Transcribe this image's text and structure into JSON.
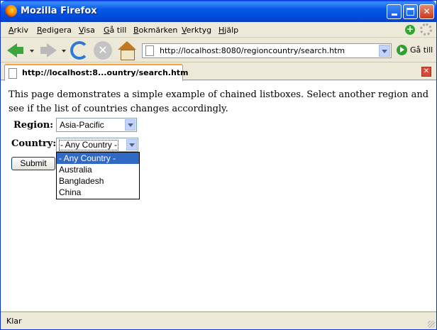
{
  "window": {
    "title": "Mozilla Firefox"
  },
  "menu": [
    "Arkiv",
    "Redigera",
    "Visa",
    "Gå till",
    "Bokmärken",
    "Verktyg",
    "Hjälp"
  ],
  "menu_underline": [
    "A",
    "R",
    "V",
    "G",
    "B",
    "V",
    "H"
  ],
  "menu_rest": [
    "rkiv",
    "edigera",
    "isa",
    "å till",
    "okmärken",
    "erktyg",
    "jälp"
  ],
  "toolbar": {
    "url": "http://localhost:8080/regioncountry/search.htm",
    "go_label": "Gå till"
  },
  "tab": {
    "label": "http://localhost:8...ountry/search.htm"
  },
  "page": {
    "intro": "This page demonstrates a simple example of chained listboxes. Select another region and see if the list of countries changes accordingly.",
    "region_label": "Region:",
    "region_value": "Asia-Pacific",
    "country_label": "Country:",
    "country_value": "- Any Country -",
    "submit_label": "Submit",
    "country_options": [
      "- Any Country -",
      "Australia",
      "Bangladesh",
      "China"
    ]
  },
  "status": {
    "text": "Klar"
  },
  "colors": {
    "title_bar": "#0558e8",
    "selection": "#316ac5",
    "chrome": "#ece9d8"
  }
}
